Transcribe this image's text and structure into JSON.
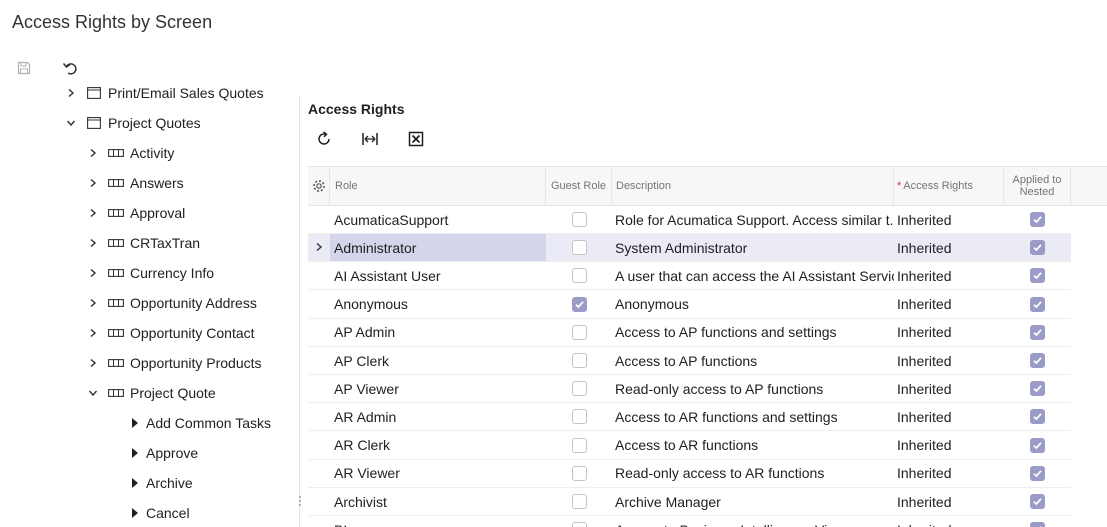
{
  "page": {
    "title": "Access Rights by Screen"
  },
  "toolbar": {
    "save_icon": "save-icon",
    "undo_icon": "undo-icon"
  },
  "tree": {
    "items": [
      {
        "label": "Print/Email Sales Quotes",
        "level": 1,
        "expander": "collapsed",
        "icon": "screen-icon"
      },
      {
        "label": "Project Quotes",
        "level": 1,
        "expander": "expanded",
        "icon": "screen-icon"
      },
      {
        "label": "Activity",
        "level": 2,
        "expander": "collapsed",
        "icon": "table-icon"
      },
      {
        "label": "Answers",
        "level": 2,
        "expander": "collapsed",
        "icon": "table-icon"
      },
      {
        "label": "Approval",
        "level": 2,
        "expander": "collapsed",
        "icon": "table-icon"
      },
      {
        "label": "CRTaxTran",
        "level": 2,
        "expander": "collapsed",
        "icon": "table-icon"
      },
      {
        "label": "Currency Info",
        "level": 2,
        "expander": "collapsed",
        "icon": "table-icon"
      },
      {
        "label": "Opportunity Address",
        "level": 2,
        "expander": "collapsed",
        "icon": "table-icon"
      },
      {
        "label": "Opportunity Contact",
        "level": 2,
        "expander": "collapsed",
        "icon": "table-icon"
      },
      {
        "label": "Opportunity Products",
        "level": 2,
        "expander": "collapsed",
        "icon": "table-icon"
      },
      {
        "label": "Project Quote",
        "level": 2,
        "expander": "expanded",
        "icon": "table-icon"
      },
      {
        "label": "Add Common Tasks",
        "level": 3,
        "expander": "none",
        "icon": "action-icon"
      },
      {
        "label": "Approve",
        "level": 3,
        "expander": "none",
        "icon": "action-icon"
      },
      {
        "label": "Archive",
        "level": 3,
        "expander": "none",
        "icon": "action-icon"
      },
      {
        "label": "Cancel",
        "level": 3,
        "expander": "none",
        "icon": "action-icon"
      }
    ]
  },
  "panel": {
    "title": "Access Rights",
    "toolbar": [
      "refresh-icon",
      "fit-columns-icon",
      "export-excel-icon"
    ]
  },
  "grid": {
    "columns": {
      "settings_icon": "gear-icon",
      "role": "Role",
      "guest_role": "Guest Role",
      "description": "Description",
      "access_rights_required": "*",
      "access_rights": "Access Rights",
      "applied_to_nested": "Applied to Nested"
    },
    "rows": [
      {
        "role": "AcumaticaSupport",
        "guest": false,
        "description": "Role for Acumatica Support. Access similar t...",
        "rights": "Inherited",
        "nested": true,
        "selected": false
      },
      {
        "role": "Administrator",
        "guest": false,
        "description": "System Administrator",
        "rights": "Inherited",
        "nested": true,
        "selected": true
      },
      {
        "role": "AI Assistant User",
        "guest": false,
        "description": "A user that can access the AI Assistant Service",
        "rights": "Inherited",
        "nested": true,
        "selected": false
      },
      {
        "role": "Anonymous",
        "guest": true,
        "description": "Anonymous",
        "rights": "Inherited",
        "nested": true,
        "selected": false
      },
      {
        "role": "AP Admin",
        "guest": false,
        "description": "Access to AP functions and settings",
        "rights": "Inherited",
        "nested": true,
        "selected": false
      },
      {
        "role": "AP Clerk",
        "guest": false,
        "description": "Access to AP functions",
        "rights": "Inherited",
        "nested": true,
        "selected": false
      },
      {
        "role": "AP Viewer",
        "guest": false,
        "description": "Read-only access to AP functions",
        "rights": "Inherited",
        "nested": true,
        "selected": false
      },
      {
        "role": "AR Admin",
        "guest": false,
        "description": "Access to AR functions and settings",
        "rights": "Inherited",
        "nested": true,
        "selected": false
      },
      {
        "role": "AR Clerk",
        "guest": false,
        "description": "Access to AR functions",
        "rights": "Inherited",
        "nested": true,
        "selected": false
      },
      {
        "role": "AR Viewer",
        "guest": false,
        "description": "Read-only access to AR functions",
        "rights": "Inherited",
        "nested": true,
        "selected": false
      },
      {
        "role": "Archivist",
        "guest": false,
        "description": "Archive Manager",
        "rights": "Inherited",
        "nested": true,
        "selected": false
      },
      {
        "role": "BI",
        "guest": false,
        "description": "Access to Business Intelligence Views",
        "rights": "Inherited",
        "nested": true,
        "selected": false
      }
    ]
  }
}
